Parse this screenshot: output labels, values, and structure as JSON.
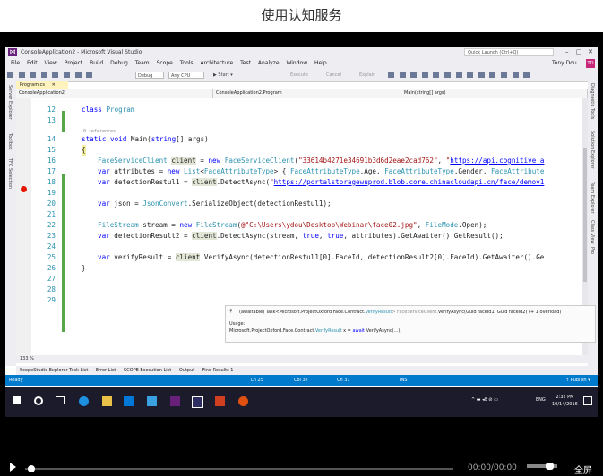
{
  "page": {
    "title": "使用认知服务"
  },
  "window": {
    "title": "ConsoleApplication2 - Microsoft Visual Studio",
    "quick_launch": "Quick Launch (Ctrl+Q)",
    "user": "Tony Dou",
    "avatar": "TD",
    "minimize": "–",
    "maximize": "□",
    "close": "✕"
  },
  "menu": [
    "File",
    "Edit",
    "View",
    "Project",
    "Build",
    "Debug",
    "Team",
    "Scope",
    "Tools",
    "Architecture",
    "Test",
    "Analyze",
    "Window",
    "Help"
  ],
  "toolbar": {
    "config": "Debug",
    "platform": "Any CPU",
    "start": "▶ Start ▾",
    "execute": "Execute",
    "cancel": "Cancel",
    "explain": "Explain"
  },
  "left_tabs": [
    "Server Explorer",
    "Toolbox",
    "TFC Selection"
  ],
  "right_tabs": [
    "Diagnostic Tools",
    "Solution Explorer",
    "Team Explorer",
    "Class View",
    "Pro"
  ],
  "doc_tab": "Program.cs",
  "nav": {
    "project": "ConsoleApplication2",
    "class": "ConsoleApplication2.Program",
    "member": "Main(string[] args)"
  },
  "code_lines": [
    {
      "n": "12",
      "code": "class Program"
    },
    {
      "n": "13",
      "code": ""
    },
    {
      "n": "",
      "code": "0 references"
    },
    {
      "n": "14",
      "code": "static void Main(string[] args)"
    },
    {
      "n": "15",
      "code": "{"
    },
    {
      "n": "16",
      "code": "FaceServiceClient client = new FaceServiceClient(\"33614b4271e34691b3d6d2eae2cad762\", \"https://api.cognitive.a"
    },
    {
      "n": "17",
      "code": "var attributes = new List<FaceAttributeType> { FaceAttributeType.Age, FaceAttributeType.Gender, FaceAttribute"
    },
    {
      "n": "18",
      "code": "var detectionRestul1 = client.DetectAsync(\"https://portalstoragewuprod.blob.core.chinacloudapi.cn/face/demov1"
    },
    {
      "n": "19",
      "code": ""
    },
    {
      "n": "20",
      "code": "var json = JsonConvert.SerializeObject(detectionRestul1);"
    },
    {
      "n": "21",
      "code": ""
    },
    {
      "n": "22",
      "code": "FileStream stream = new FileStream(@\"C:\\Users\\ydou\\Desktop\\Webinar\\face02.jpg\", FileMode.Open);"
    },
    {
      "n": "23",
      "code": "var detectionResult2 = client.DetectAsync(stream, true, true, attributes).GetAwaiter().GetResult();"
    },
    {
      "n": "24",
      "code": ""
    },
    {
      "n": "25",
      "code": "var verifyResult = client.VerifyAsync(detectionRestul1[0].FaceId, detectionResult2[0].FaceId).GetAwaiter().Ge"
    },
    {
      "n": "26",
      "code": "}"
    },
    {
      "n": "27",
      "code": ""
    },
    {
      "n": "28",
      "code": ""
    },
    {
      "n": "29",
      "code": ""
    }
  ],
  "tooltip": {
    "icon": "⚲",
    "sig_a": "(awaitable) Task<Microsoft.ProjectOxford.Face.Contract.",
    "sig_b": "VerifyResult",
    "sig_c": "> FaceServiceClient.",
    "sig_d": "VerifyAsync(Guid faceId1, Guid faceId2) (+ 1 overload)",
    "usage_label": "Usage:",
    "usage_a": "Microsoft.ProjectOxford.Face.Contract.",
    "usage_b": "VerifyResult",
    "usage_c": " x = ",
    "usage_d": "await",
    "usage_e": " VerifyAsync(...);"
  },
  "zoom": "133 %",
  "bottom_tabs": [
    "ScopeStudio Explorer Task List",
    "Error List",
    "SCOPE Execution List",
    "Output",
    "Find Results 1"
  ],
  "status": {
    "ready": "Ready",
    "ln": "Ln 25",
    "col": "Col 37",
    "ch": "Ch 37",
    "ins": "INS",
    "publish": "↑ Publish ▾"
  },
  "taskbar": {
    "lang": "ENG",
    "time": "2:32 PM",
    "date": "10/14/2016"
  },
  "player": {
    "time": "00:00/00:00",
    "fullscreen": "全屏"
  }
}
